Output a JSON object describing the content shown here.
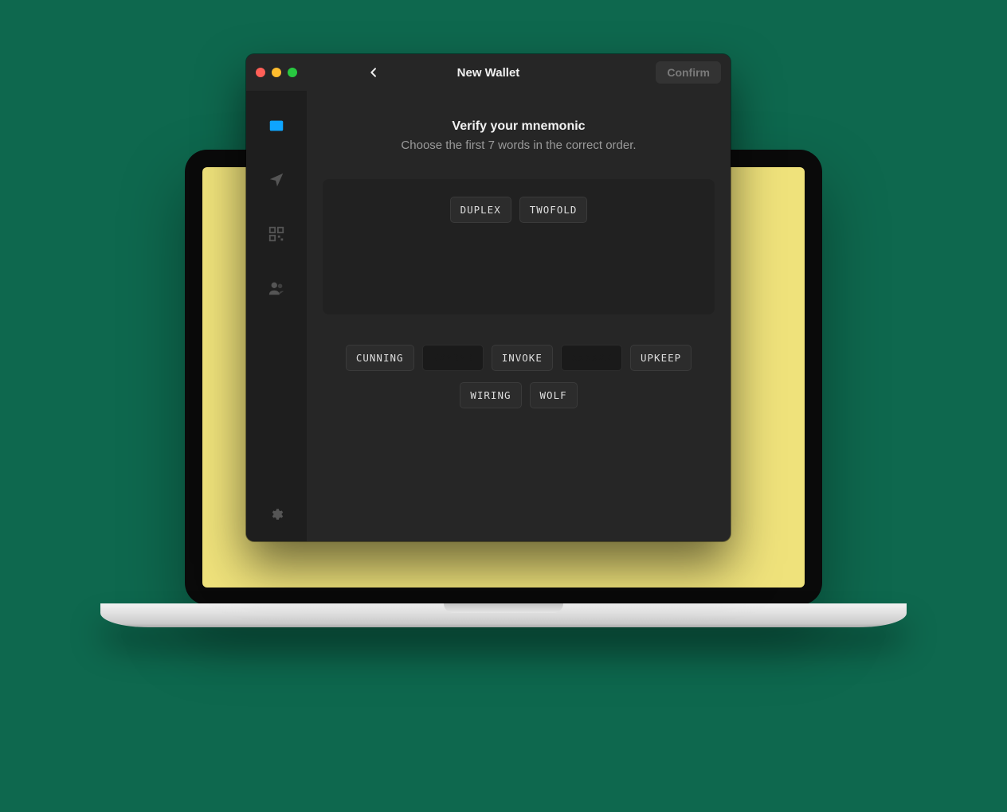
{
  "titlebar": {
    "title": "New Wallet",
    "confirm_label": "Confirm"
  },
  "sidebar": {
    "items": [
      {
        "name": "wallet",
        "active": true
      },
      {
        "name": "send",
        "active": false
      },
      {
        "name": "qr",
        "active": false
      },
      {
        "name": "contacts",
        "active": false
      }
    ]
  },
  "main": {
    "heading": "Verify your mnemonic",
    "subheading": "Choose the first 7 words in the correct order.",
    "selected_words": [
      "DUPLEX",
      "TWOFOLD"
    ],
    "available_words": [
      {
        "label": "CUNNING",
        "hidden": false
      },
      {
        "label": "",
        "hidden": true
      },
      {
        "label": "INVOKE",
        "hidden": false
      },
      {
        "label": "",
        "hidden": true
      },
      {
        "label": "UPKEEP",
        "hidden": false
      },
      {
        "label": "WIRING",
        "hidden": false
      },
      {
        "label": "WOLF",
        "hidden": false
      }
    ]
  }
}
